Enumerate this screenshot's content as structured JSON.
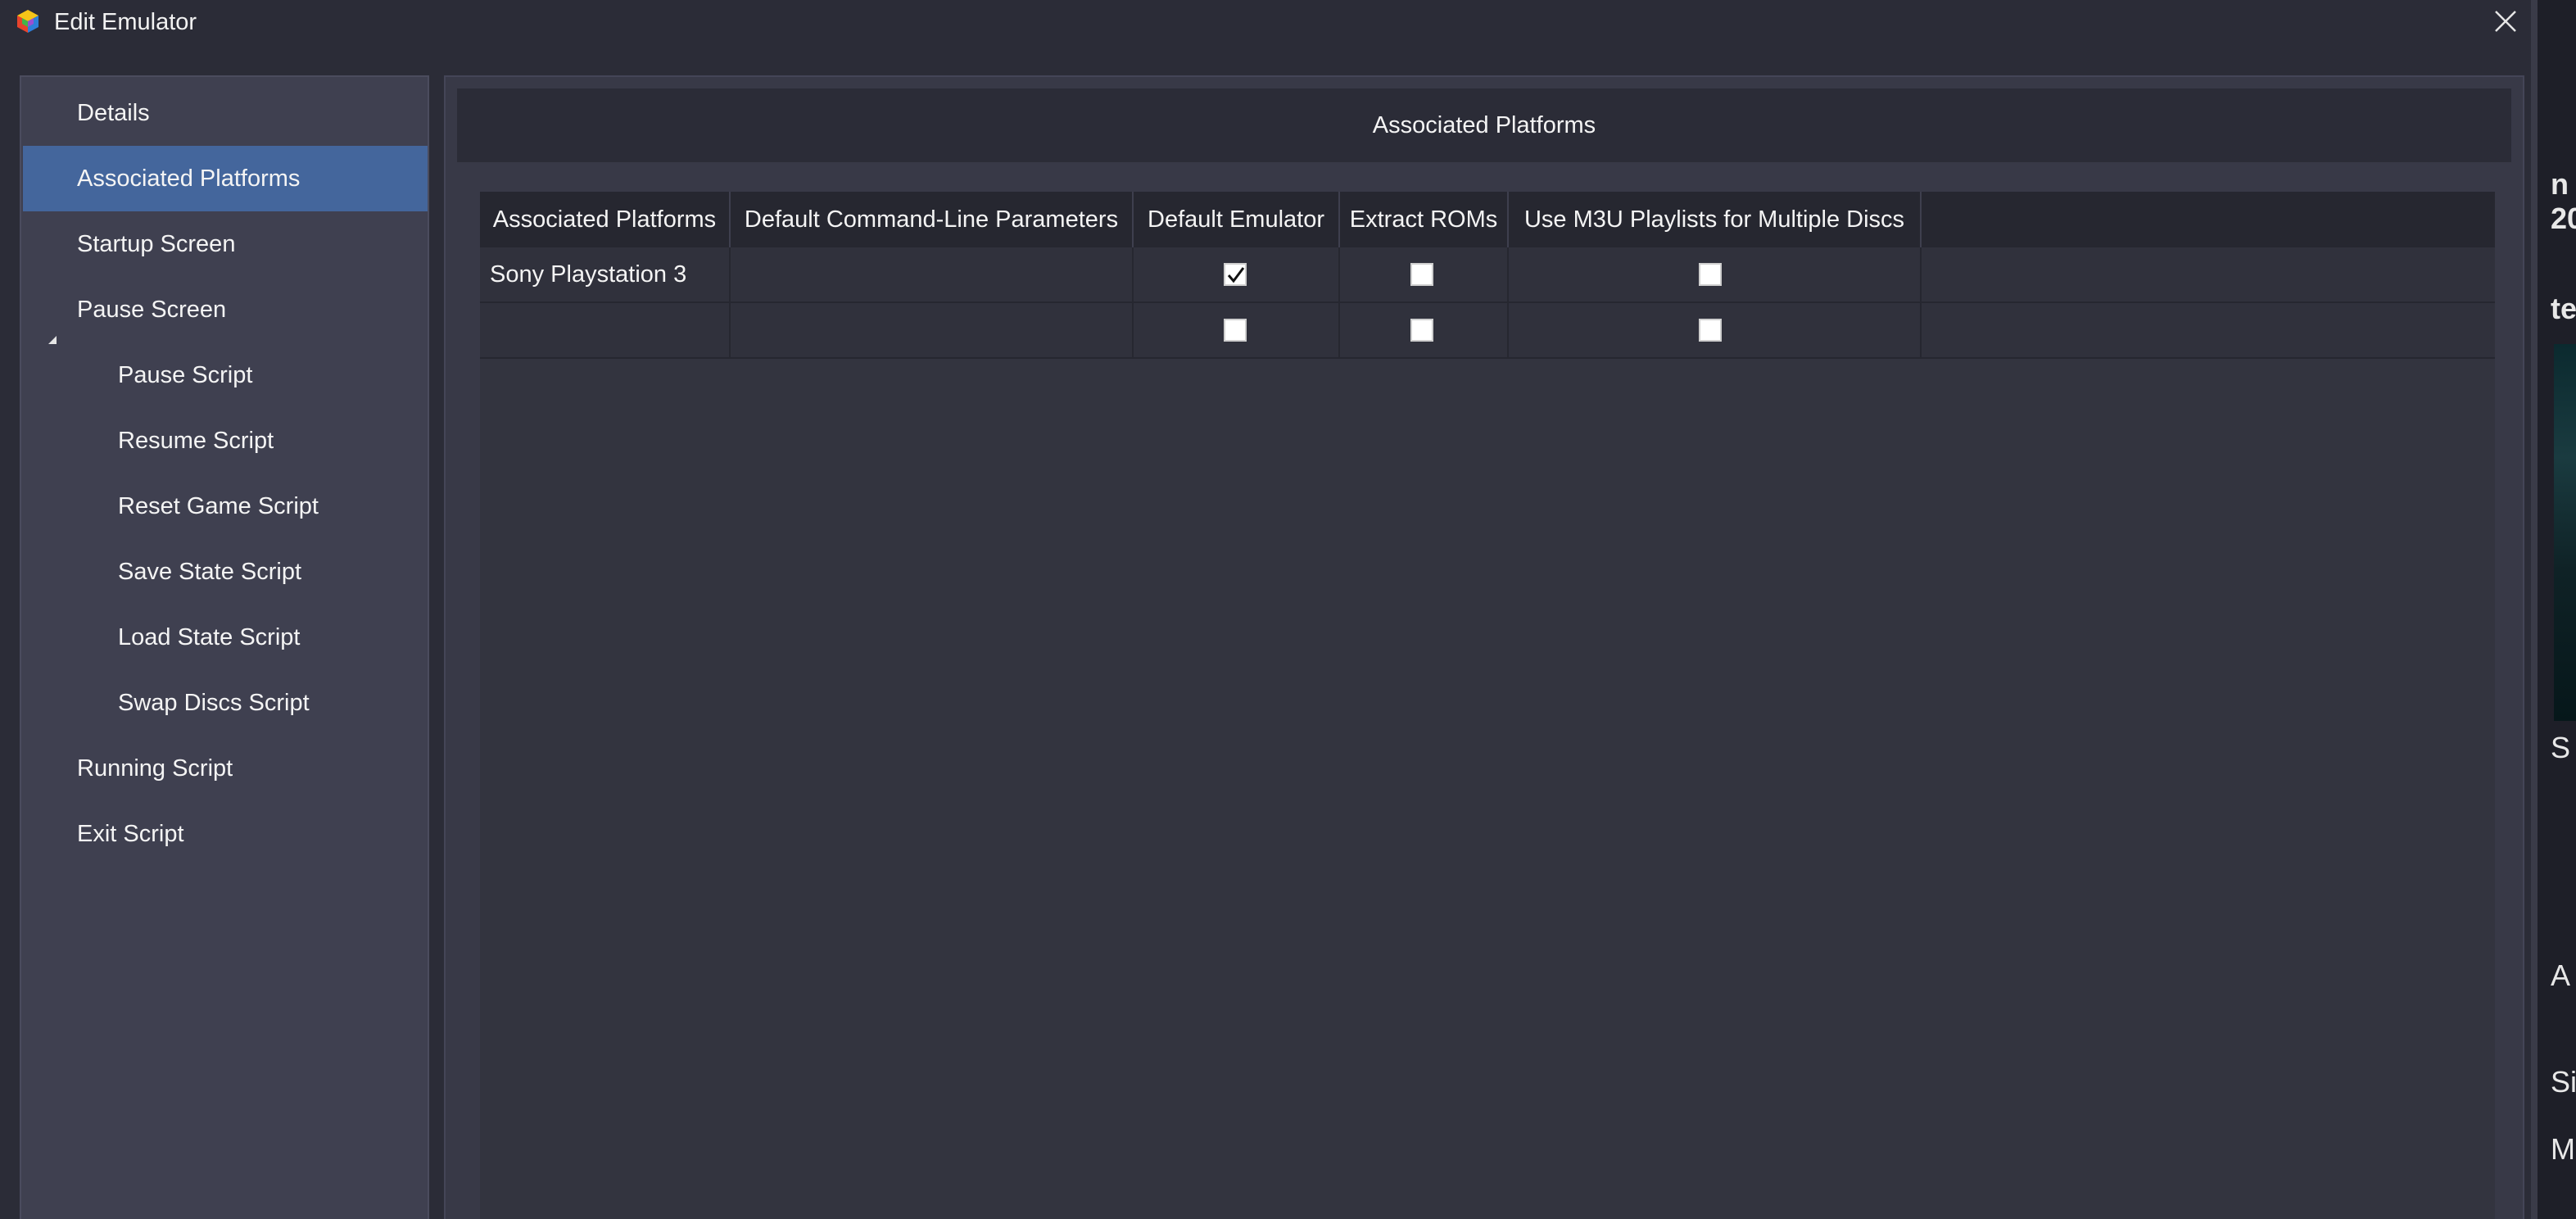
{
  "window": {
    "title": "Edit Emulator",
    "close_icon": "close-icon",
    "app_icon": "launchbox-cube-icon"
  },
  "sidebar": {
    "items": [
      {
        "label": "Details",
        "level": 1,
        "selected": false
      },
      {
        "label": "Associated Platforms",
        "level": 1,
        "selected": true
      },
      {
        "label": "Startup Screen",
        "level": 1,
        "selected": false
      },
      {
        "label": "Pause Screen",
        "level": 1,
        "selected": false,
        "expanded": true
      },
      {
        "label": "Pause Script",
        "level": 2,
        "selected": false
      },
      {
        "label": "Resume Script",
        "level": 2,
        "selected": false
      },
      {
        "label": "Reset Game Script",
        "level": 2,
        "selected": false
      },
      {
        "label": "Save State Script",
        "level": 2,
        "selected": false
      },
      {
        "label": "Load State Script",
        "level": 2,
        "selected": false
      },
      {
        "label": "Swap Discs Script",
        "level": 2,
        "selected": false
      },
      {
        "label": "Running Script",
        "level": 1,
        "selected": false
      },
      {
        "label": "Exit Script",
        "level": 1,
        "selected": false
      }
    ]
  },
  "main": {
    "section_title": "Associated Platforms",
    "grid": {
      "columns": [
        "Associated Platforms",
        "Default Command-Line Parameters",
        "Default Emulator",
        "Extract ROMs",
        "Use M3U Playlists for Multiple Discs"
      ],
      "rows": [
        {
          "platform": "Sony Playstation 3",
          "parameters": "",
          "default_emulator": true,
          "extract_roms": false,
          "use_m3u": false
        },
        {
          "platform": "",
          "parameters": "",
          "default_emulator": false,
          "extract_roms": false,
          "use_m3u": false
        }
      ]
    }
  },
  "background": {
    "fragments": [
      "n",
      "20",
      "te",
      "S",
      "A",
      "Sir",
      "M"
    ]
  },
  "colors": {
    "selected_item": "#44669c",
    "panel_bg": "#383947",
    "sidebar_bg": "#3f4050",
    "titlebar_bg": "#2b2c37"
  }
}
